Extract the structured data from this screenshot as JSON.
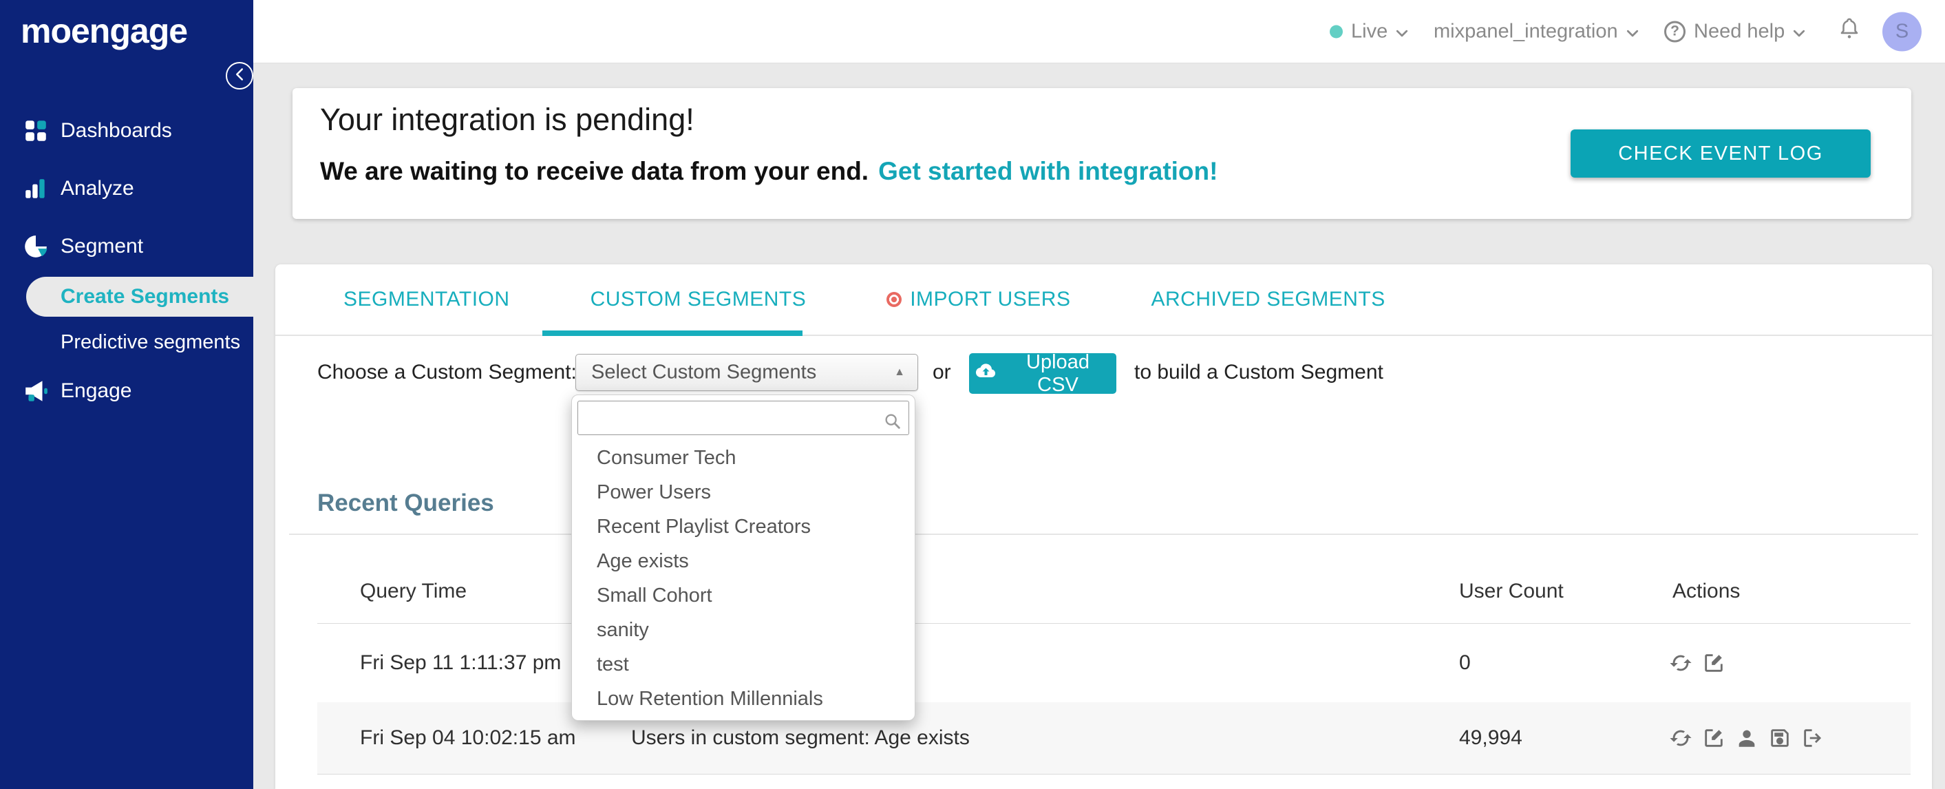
{
  "sidebar": {
    "logo": "moengage",
    "items": [
      {
        "label": "Dashboards"
      },
      {
        "label": "Analyze"
      },
      {
        "label": "Segment"
      },
      {
        "label": "Create Segments"
      },
      {
        "label": "Predictive segments"
      },
      {
        "label": "Engage"
      }
    ]
  },
  "topbar": {
    "environment": "Live",
    "workspace": "mixpanel_integration",
    "help": "Need help",
    "avatar_initial": "S"
  },
  "banner": {
    "title": "Your integration is pending!",
    "message": "We are waiting to receive data from your end.",
    "link": "Get started with integration!",
    "button": "CHECK EVENT LOG"
  },
  "tabs": [
    {
      "label": "SEGMENTATION"
    },
    {
      "label": "CUSTOM SEGMENTS"
    },
    {
      "label": "IMPORT USERS"
    },
    {
      "label": "ARCHIVED SEGMENTS"
    }
  ],
  "controls": {
    "label": "Choose a Custom Segment:",
    "select_value": "Select Custom Segments",
    "or": "or",
    "upload_button": "Upload CSV",
    "suffix": "to build a Custom Segment"
  },
  "dropdown": {
    "search_value": "",
    "items": [
      "Consumer Tech",
      "Power Users",
      "Recent Playlist Creators",
      "Age exists",
      "Small Cohort",
      "sanity",
      "test",
      "Low Retention Millennials"
    ]
  },
  "recent_queries": {
    "title": "Recent Queries",
    "columns": [
      "Query Time",
      "User Count",
      "Actions"
    ],
    "rows": [
      {
        "query_time": "Fri Sep 11 1:11:37 pm",
        "query": "",
        "user_count": "0"
      },
      {
        "query_time": "Fri Sep 04 10:02:15 am",
        "query": "Users in custom segment: Age exists",
        "user_count": "49,994"
      }
    ]
  },
  "colors": {
    "accent_teal": "#12a5b6",
    "sidebar_navy": "#0c2379",
    "live_dot": "#63cfc4",
    "avatar_bg": "#a9b0f2",
    "import_dot": "#e96a62",
    "heading_slate": "#567d91"
  }
}
